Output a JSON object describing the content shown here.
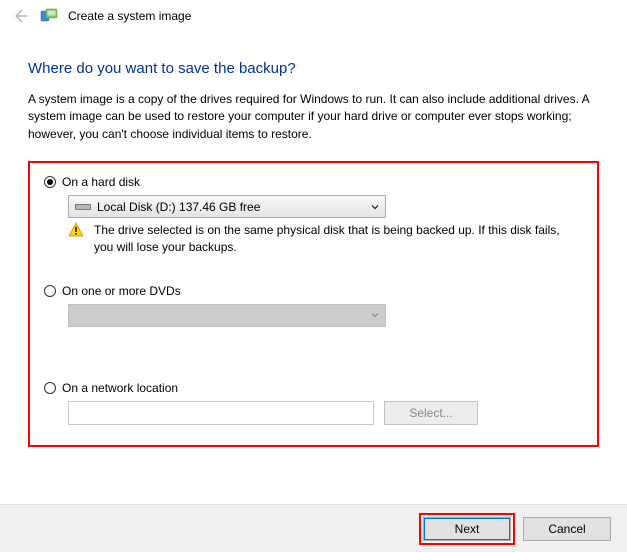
{
  "window": {
    "title": "Create a system image"
  },
  "heading": "Where do you want to save the backup?",
  "intro": "A system image is a copy of the drives required for Windows to run. It can also include additional drives. A system image can be used to restore your computer if your hard drive or computer ever stops working; however, you can't choose individual items to restore.",
  "options": {
    "hard_disk": {
      "label": "On a hard disk",
      "selected_drive": "Local Disk (D:)  137.46 GB free",
      "warning": "The drive selected is on the same physical disk that is being backed up. If this disk fails, you will lose your backups."
    },
    "dvds": {
      "label": "On one or more DVDs"
    },
    "network": {
      "label": "On a network location",
      "select_btn": "Select..."
    }
  },
  "footer": {
    "next": "Next",
    "cancel": "Cancel"
  }
}
